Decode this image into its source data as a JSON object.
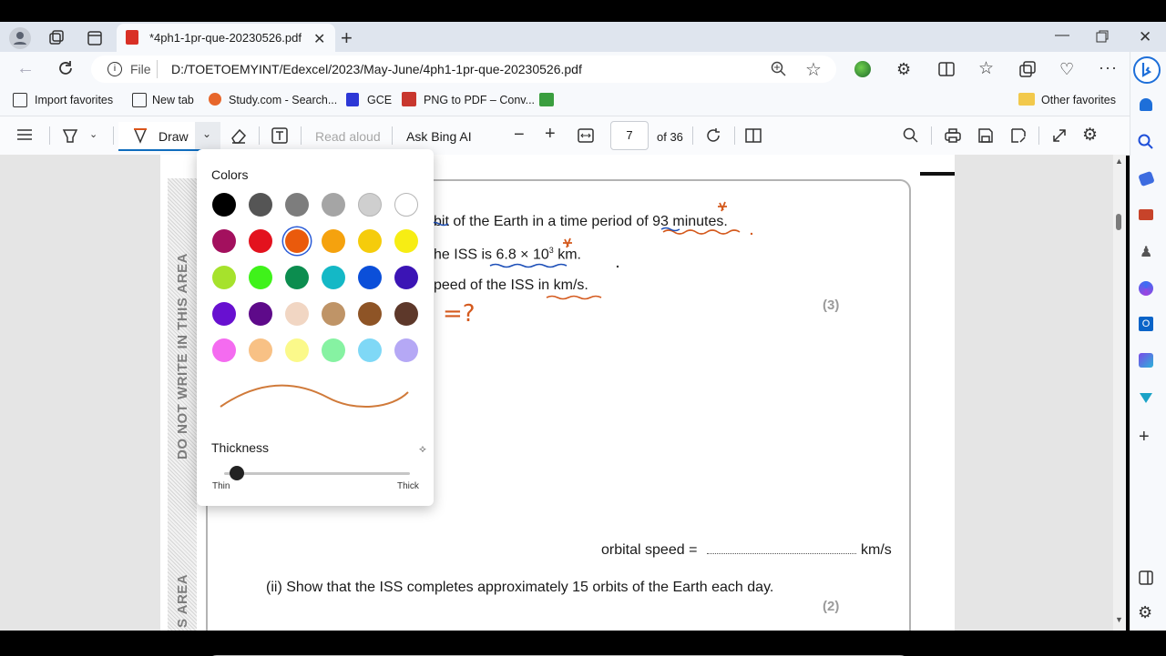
{
  "browser": {
    "tab_title": "*4ph1-1pr-que-20230526.pdf",
    "address_prefix": "File",
    "address": "D:/TOETOEMYINT/Edexcel/2023/May-June/4ph1-1pr-que-20230526.pdf"
  },
  "favorites": {
    "items": [
      "Import favorites",
      "New tab",
      "Study.com - Search...",
      "GCE",
      "PNG to PDF – Conv..."
    ],
    "other": "Other favorites"
  },
  "pdf_toolbar": {
    "draw_label": "Draw",
    "read_aloud": "Read aloud",
    "ask_bing": "Ask Bing AI",
    "page_current": "7",
    "page_total": "of 36"
  },
  "draw_popup": {
    "colors_label": "Colors",
    "colors": [
      "#000000",
      "#555555",
      "#7d7d7d",
      "#a5a5a5",
      "#cfcfcf",
      "#ffffff",
      "#a3105e",
      "#e3121e",
      "#ea5a0c",
      "#f5a20e",
      "#f5cc0b",
      "#f7ed14",
      "#a6e22c",
      "#3ff21a",
      "#0c8d4f",
      "#14b8c6",
      "#0b4fd9",
      "#3b14b5",
      "#6810d0",
      "#5e0a8a",
      "#f1d6c3",
      "#bf9467",
      "#8e5426",
      "#5d382a",
      "#f46bf0",
      "#f8c185",
      "#fbf98a",
      "#86f2a2",
      "#7fd8f6",
      "#b5a8f5"
    ],
    "selected_color": "#ea5a0c",
    "thickness_label": "Thickness",
    "thin_label": "Thin",
    "thick_label": "Thick",
    "thickness_value": 0.05
  },
  "document": {
    "margin_text_1": "DO NOT WRITE IN THIS AREA",
    "margin_text_2": "S AREA",
    "line1": "bit of the Earth in a time period of 93 minutes.",
    "line2_pre": "he ISS is 6.8 × 10",
    "line2_sup": "3",
    "line2_post": " km.",
    "line3": "peed of the ISS in km/s.",
    "marks_3": "(3)",
    "answer_label": "orbital speed =",
    "answer_unit": "km/s",
    "question_ii": "(ii)  Show that the ISS completes approximately 15 orbits of the Earth each day.",
    "marks_2": "(2)",
    "annotation_q": "=?"
  }
}
